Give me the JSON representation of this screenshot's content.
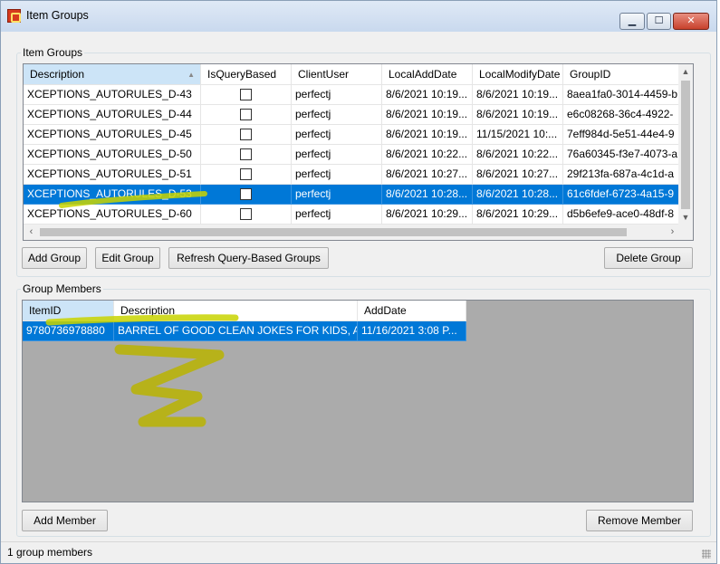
{
  "window": {
    "title": "Item Groups",
    "min_icon": "minimize-icon",
    "max_icon": "maximize-icon",
    "close_icon": "close-icon"
  },
  "item_groups": {
    "legend": "Item Groups",
    "columns": [
      "Description",
      "IsQueryBased",
      "ClientUser",
      "LocalAddDate",
      "LocalModifyDate",
      "GroupID"
    ],
    "rows": [
      {
        "description": "XCEPTIONS_AUTORULES_D-43",
        "is_query_based": false,
        "client_user": "perfectj",
        "local_add_date": "8/6/2021 10:19...",
        "local_modify_date": "8/6/2021 10:19...",
        "group_id": "8aea1fa0-3014-4459-b"
      },
      {
        "description": "XCEPTIONS_AUTORULES_D-44",
        "is_query_based": false,
        "client_user": "perfectj",
        "local_add_date": "8/6/2021 10:19...",
        "local_modify_date": "8/6/2021 10:19...",
        "group_id": "e6c08268-36c4-4922-"
      },
      {
        "description": "XCEPTIONS_AUTORULES_D-45",
        "is_query_based": false,
        "client_user": "perfectj",
        "local_add_date": "8/6/2021 10:19...",
        "local_modify_date": "11/15/2021 10:...",
        "group_id": "7eff984d-5e51-44e4-9"
      },
      {
        "description": "XCEPTIONS_AUTORULES_D-50",
        "is_query_based": false,
        "client_user": "perfectj",
        "local_add_date": "8/6/2021 10:22...",
        "local_modify_date": "8/6/2021 10:22...",
        "group_id": "76a60345-f3e7-4073-a"
      },
      {
        "description": "XCEPTIONS_AUTORULES_D-51",
        "is_query_based": false,
        "client_user": "perfectj",
        "local_add_date": "8/6/2021 10:27...",
        "local_modify_date": "8/6/2021 10:27...",
        "group_id": "29f213fa-687a-4c1d-a"
      },
      {
        "description": "XCEPTIONS_AUTORULES_D-53",
        "is_query_based": false,
        "client_user": "perfectj",
        "local_add_date": "8/6/2021 10:28...",
        "local_modify_date": "8/6/2021 10:28...",
        "group_id": "61c6fdef-6723-4a15-9",
        "selected": true
      },
      {
        "description": "XCEPTIONS_AUTORULES_D-60",
        "is_query_based": false,
        "client_user": "perfectj",
        "local_add_date": "8/6/2021 10:29...",
        "local_modify_date": "8/6/2021 10:29...",
        "group_id": "d5b6efe9-ace0-48df-8"
      }
    ],
    "buttons": {
      "add": "Add Group",
      "edit": "Edit Group",
      "refresh": "Refresh Query-Based Groups",
      "delete": "Delete Group"
    }
  },
  "group_members": {
    "legend": "Group Members",
    "columns": [
      "ItemID",
      "Description",
      "AddDate"
    ],
    "rows": [
      {
        "item_id": "9780736978880",
        "description": "BARREL OF GOOD CLEAN JOKES FOR KIDS, A",
        "add_date": "11/16/2021 3:08 P...",
        "selected": true
      }
    ],
    "buttons": {
      "add": "Add Member",
      "remove": "Remove Member"
    }
  },
  "status": {
    "text": "1 group members"
  },
  "colors": {
    "selection": "#0078d7",
    "annotation": "#c8d400",
    "grid_empty": "#ababab"
  }
}
